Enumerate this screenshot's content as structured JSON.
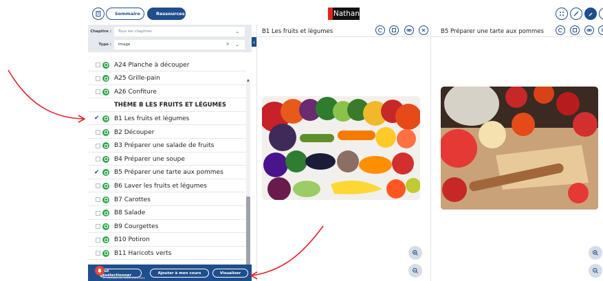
{
  "header": {
    "sommaire_label": "Sommaire",
    "ressources_label": "Ressources",
    "logo_text": "Nathan"
  },
  "filters": {
    "chapitre_label": "Chapitre :",
    "chapitre_placeholder": "Tous les chapitres",
    "type_label": "Type :",
    "type_value": "Image"
  },
  "list": [
    {
      "label": "A24 Planche à découper",
      "checked": false
    },
    {
      "label": "A25 Grille-pain",
      "checked": false
    },
    {
      "label": "A26 Confiture",
      "checked": false
    },
    {
      "label": "B1 Les fruits et légumes",
      "checked": true
    },
    {
      "label": "B2 Découper",
      "checked": false
    },
    {
      "label": "B3 Préparer une salade de fruits",
      "checked": false
    },
    {
      "label": "B4 Préparer une soupe",
      "checked": false
    },
    {
      "label": "B5 Préparer une tarte aux pommes",
      "checked": true
    },
    {
      "label": "B6 Laver les fruits et légumes",
      "checked": false
    },
    {
      "label": "B7 Carottes",
      "checked": false
    },
    {
      "label": "B8 Salade",
      "checked": false
    },
    {
      "label": "B9 Courgettes",
      "checked": false
    },
    {
      "label": "B10 Potiron",
      "checked": false
    },
    {
      "label": "B11 Haricots verts",
      "checked": false
    }
  ],
  "theme_heading": "THÈME B LES FRUITS ET LÉGUMES",
  "bottom": {
    "deselect_label": "Tout désélectionner",
    "deselect_sub": "2 ressources sélectionnées",
    "add_label": "Ajouter à mon cours",
    "view_label": "Visualiser"
  },
  "viewer1": {
    "title": "B1 Les fruits et légumes"
  },
  "viewer2": {
    "title": "B5 Préparer une tarte aux pommes"
  },
  "colors": {
    "primary": "#1f4e8c",
    "green": "#2fa84f",
    "filter_bg": "#e6e9ee"
  }
}
